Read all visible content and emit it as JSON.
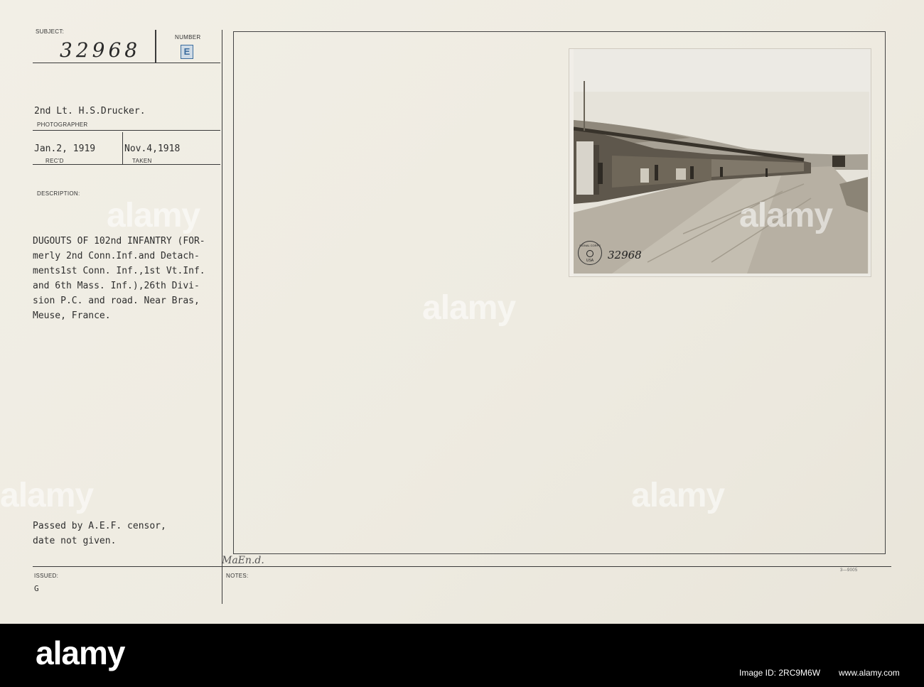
{
  "card": {
    "subject_label": "SUBJECT:",
    "subject_number": "32968",
    "number_label": "NUMBER",
    "number_value": "E",
    "photographer_name": "2nd Lt. H.S.Drucker.",
    "photographer_label": "PHOTOGRAPHER",
    "received_date": "Jan.2, 1919",
    "received_label": "REC'D",
    "taken_date": "Nov.4,1918",
    "taken_label": "TAKEN",
    "description_label": "DESCRIPTION:",
    "description_lines": [
      "DUGOUTS OF 102nd INFANTRY (FOR-",
      "merly 2nd Conn.Inf.and Detach-",
      "ments1st Conn. Inf.,1st Vt.Inf.",
      "and 6th Mass. Inf.),26th Divi-",
      "sion P.C. and road. Near Bras,",
      "Meuse, France."
    ],
    "censor_lines": [
      "Passed by A.E.F. censor,",
      "date not given."
    ],
    "issued_label": "ISSUED:",
    "issued_value": "G",
    "notes_label": "NOTES:",
    "notes_handwritten": "MaEn.d.",
    "form_number": "3—9005"
  },
  "photo": {
    "stamp_text": "SIGNAL CORPS",
    "stamp_sub": "USA",
    "photo_number": "32968"
  },
  "watermark": {
    "text": "alamy"
  },
  "footer": {
    "brand": "alamy",
    "image_id": "Image ID: 2RC9M6W",
    "site": "www.alamy.com"
  }
}
